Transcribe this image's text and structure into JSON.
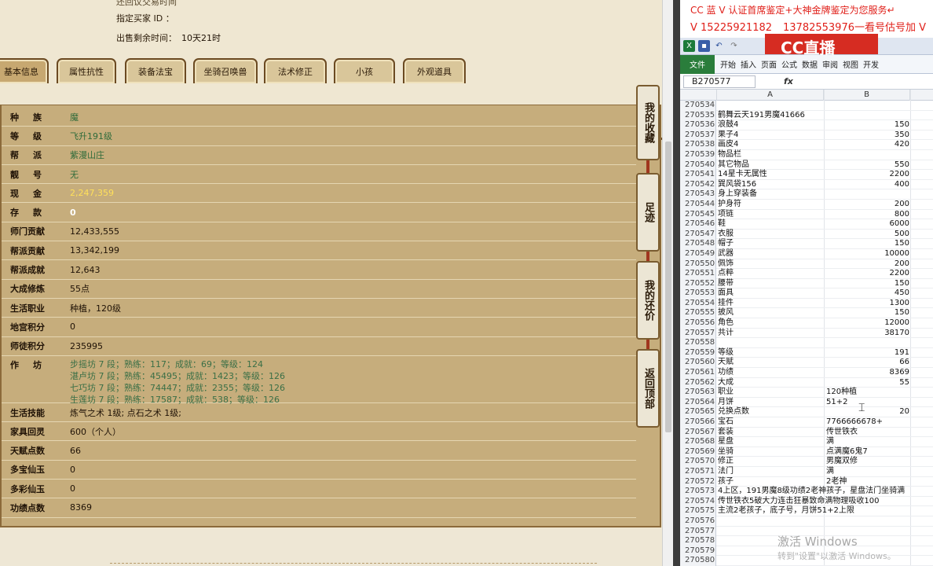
{
  "sale_info": {
    "cut_line": "还回议交易时间",
    "buyer_label": "指定买家 ID ：",
    "time_label": "出售剩余时间：",
    "time_value": "10天21时"
  },
  "tabs": [
    "基本信息",
    "属性抗性",
    "装备法宝",
    "坐骑召唤兽",
    "法术修正",
    "小孩",
    "外观道具"
  ],
  "attributes": [
    {
      "label": "种族",
      "value": "魔"
    },
    {
      "label": "等级",
      "value": "飞升191级"
    },
    {
      "label": "帮派",
      "value": "紫漫山庄"
    },
    {
      "label": "靓号",
      "value": "无"
    },
    {
      "label": "现金",
      "value": "2,247,359"
    },
    {
      "label": "存款",
      "value": "0"
    },
    {
      "label": "师门贡献",
      "value": "12,433,555"
    },
    {
      "label": "帮派贡献",
      "value": "13,342,199"
    },
    {
      "label": "帮派成就",
      "value": "12,643"
    },
    {
      "label": "大成修炼",
      "value": "55点"
    },
    {
      "label": "生活职业",
      "value": "种植，120级"
    },
    {
      "label": "地宫积分",
      "value": "0"
    },
    {
      "label": "师徒积分",
      "value": "235995"
    }
  ],
  "workshop_label": "作坊",
  "workshops": [
    "步摇坊 7 段；熟练：117；成就：69；等级：124",
    "湛卢坊 7 段；熟练：45495；成就：1423；等级：126",
    "七巧坊 7 段；熟练：74447；成就：2355；等级：126",
    "生莲坊 7 段；熟练：17587；成就：538；等级：126"
  ],
  "attributes2": [
    {
      "label": "生活技能",
      "value": "炼气之术 1级; 点石之术 1级;"
    },
    {
      "label": "家具回灵",
      "value": "600（个人）"
    },
    {
      "label": "天赋点数",
      "value": "66"
    },
    {
      "label": "多宝仙玉",
      "value": "0"
    },
    {
      "label": "多彩仙玉",
      "value": "0"
    },
    {
      "label": "功绩点数",
      "value": "8369"
    }
  ],
  "side_buttons": [
    "我的收藏",
    "足迹",
    "我的还价",
    "返回顶部"
  ],
  "banner": {
    "line1": "CC 蓝 V 认证首席鉴定+大神金牌鉴定为您服务↵",
    "line2_a": "V 15225921182",
    "line2_b": "13782553976一看号估号加 V",
    "logo": "CC直播"
  },
  "excel": {
    "ribbon_tabs": [
      "文件",
      "开始",
      "插入",
      "页面",
      "公式",
      "数据",
      "审阅",
      "视图",
      "开发"
    ],
    "name_box": "B270577",
    "fx": "fx",
    "col_a": "A",
    "col_b": "B",
    "rows": [
      {
        "n": "270534",
        "a": "",
        "b": ""
      },
      {
        "n": "270535",
        "a": "鹤舞云天191男魔41666",
        "b": ""
      },
      {
        "n": "270536",
        "a": "浪鼓4",
        "b": "150"
      },
      {
        "n": "270537",
        "a": "果子4",
        "b": "350"
      },
      {
        "n": "270538",
        "a": "画皮4",
        "b": "420"
      },
      {
        "n": "270539",
        "a": "物品栏",
        "b": ""
      },
      {
        "n": "270540",
        "a": "其它物品",
        "b": "550"
      },
      {
        "n": "270541",
        "a": "14星卡无属性",
        "b": "2200"
      },
      {
        "n": "270542",
        "a": "巽风袋156",
        "b": "400"
      },
      {
        "n": "270543",
        "a": "身上穿装备",
        "b": ""
      },
      {
        "n": "270544",
        "a": "护身符",
        "b": "200"
      },
      {
        "n": "270545",
        "a": "项链",
        "b": "800"
      },
      {
        "n": "270546",
        "a": "鞋",
        "b": "6000"
      },
      {
        "n": "270547",
        "a": "衣服",
        "b": "500"
      },
      {
        "n": "270548",
        "a": "帽子",
        "b": "150"
      },
      {
        "n": "270549",
        "a": "武器",
        "b": "10000"
      },
      {
        "n": "270550",
        "a": "佩饰",
        "b": "200"
      },
      {
        "n": "270551",
        "a": "点粹",
        "b": "2200"
      },
      {
        "n": "270552",
        "a": "腰带",
        "b": "150"
      },
      {
        "n": "270553",
        "a": "面具",
        "b": "450"
      },
      {
        "n": "270554",
        "a": "挂件",
        "b": "1300"
      },
      {
        "n": "270555",
        "a": "披风",
        "b": "150"
      },
      {
        "n": "270556",
        "a": "角色",
        "b": "12000"
      },
      {
        "n": "270557",
        "a": "共计",
        "b": "38170"
      },
      {
        "n": "270558",
        "a": "",
        "b": ""
      },
      {
        "n": "270559",
        "a": "等级",
        "b": "191"
      },
      {
        "n": "270560",
        "a": "天赋",
        "b": "66"
      },
      {
        "n": "270561",
        "a": "功绩",
        "b": "8369"
      },
      {
        "n": "270562",
        "a": "大成",
        "b": "55"
      },
      {
        "n": "270563",
        "a": "职业",
        "bl": "120种植"
      },
      {
        "n": "270564",
        "a": "月饼",
        "bl": "51+2"
      },
      {
        "n": "270565",
        "a": "兑换点数",
        "b": "20"
      },
      {
        "n": "270566",
        "a": "宝石",
        "bl": "7766666678+"
      },
      {
        "n": "270567",
        "a": "套装",
        "bl": "传世铁衣"
      },
      {
        "n": "270568",
        "a": "星盘",
        "bl": "满"
      },
      {
        "n": "270569",
        "a": "坐骑",
        "bl": "点满魔6鬼7"
      },
      {
        "n": "270570",
        "a": "修正",
        "bl": "男魔双修"
      },
      {
        "n": "270571",
        "a": "法门",
        "bl": "满"
      },
      {
        "n": "270572",
        "a": "孩子",
        "bl": "2老神"
      },
      {
        "n": "270573",
        "a": "4上区，191男魔8级功绩2老神孩子，星盘法门坐骑满",
        "b": ""
      },
      {
        "n": "270574",
        "a": "传世铁衣5破大力连击狂暴致命满物理吸收100",
        "b": ""
      },
      {
        "n": "270575",
        "a": "主流2老孩子，底子号，月饼51+2上限",
        "b": ""
      },
      {
        "n": "270576",
        "a": "",
        "b": ""
      },
      {
        "n": "270577",
        "a": "",
        "b": ""
      },
      {
        "n": "270578",
        "a": "",
        "b": ""
      },
      {
        "n": "270579",
        "a": "",
        "b": ""
      },
      {
        "n": "270580",
        "a": "",
        "b": ""
      }
    ]
  },
  "watermark": {
    "line1": "激活 Windows",
    "line2": "转到\"设置\"以激活 Windows。"
  },
  "colors": {
    "panel_bg": "#c6ad7c",
    "tab_border": "#6b4a22",
    "banner_red": "#e0201a",
    "excel_green": "#2a7d3b"
  }
}
